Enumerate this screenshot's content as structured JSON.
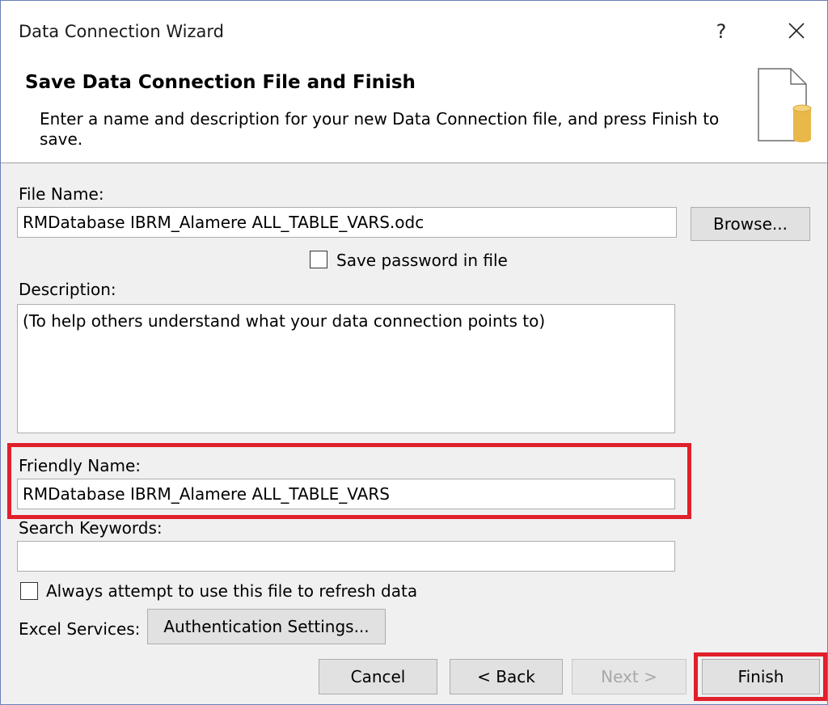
{
  "window": {
    "title": "Data Connection Wizard",
    "help": "?"
  },
  "header": {
    "heading": "Save Data Connection File and Finish",
    "subtext": "Enter a name and description for your new Data Connection file, and press Finish to save."
  },
  "form": {
    "file_name": {
      "label": "File Name:",
      "value": "RMDatabase IBRM_Alamere ALL_TABLE_VARS.odc"
    },
    "browse_label": "Browse...",
    "save_password": {
      "label": "Save password in file",
      "checked": false
    },
    "description": {
      "label": "Description:",
      "value": "(To help others understand what your data connection points to)"
    },
    "friendly_name": {
      "label": "Friendly Name:",
      "value": "RMDatabase IBRM_Alamere ALL_TABLE_VARS"
    },
    "search_keywords": {
      "label": "Search Keywords:",
      "value": ""
    },
    "always_refresh": {
      "label": "Always attempt to use this file to refresh data",
      "checked": false
    },
    "excel_services_label": "Excel Services:",
    "auth_settings_label": "Authentication Settings..."
  },
  "footer": {
    "cancel": "Cancel",
    "back": "< Back",
    "next": "Next >",
    "finish": "Finish"
  },
  "colors": {
    "highlight": "#e0202a",
    "window_bg": "#f0f0f0",
    "button_bg": "#e1e1e1"
  }
}
